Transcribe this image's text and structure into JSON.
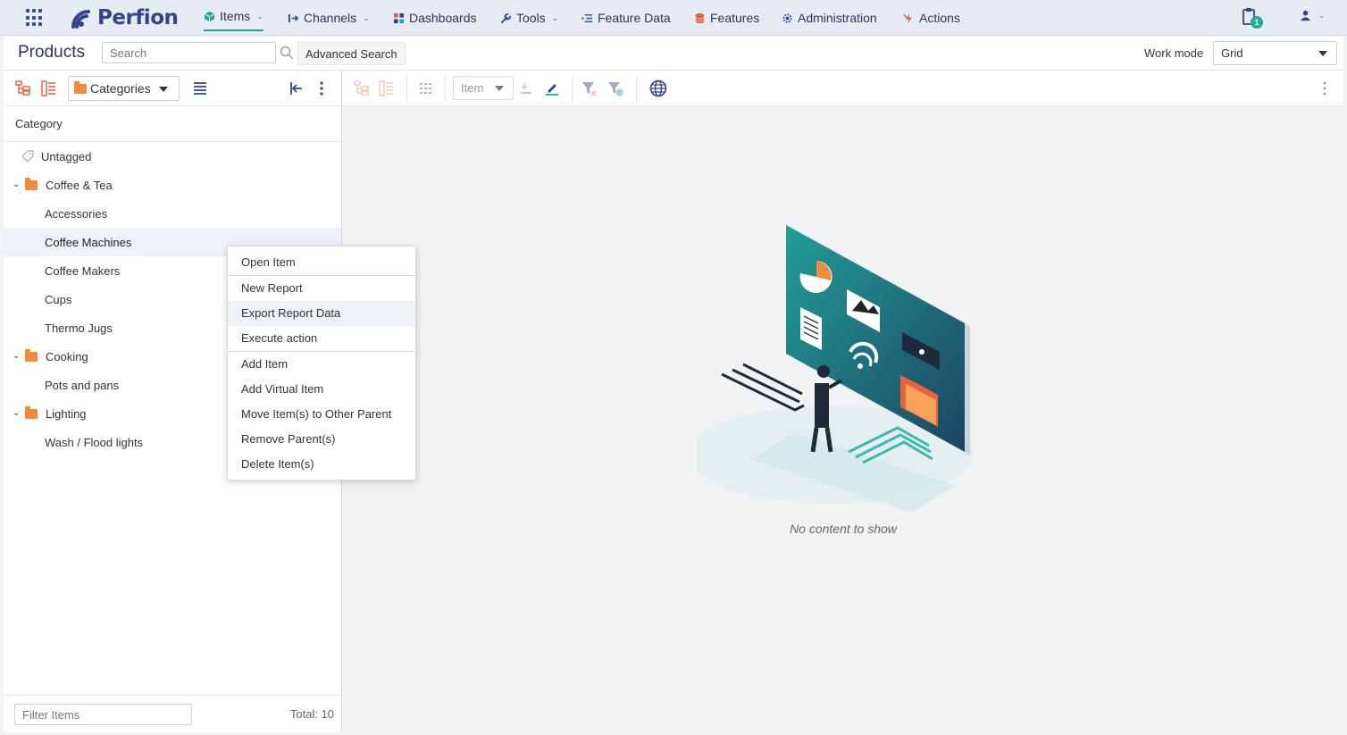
{
  "app": {
    "name": "Perfion",
    "nav": [
      {
        "label": "Items",
        "has_menu": true,
        "active": true
      },
      {
        "label": "Channels",
        "has_menu": true
      },
      {
        "label": "Dashboards",
        "has_menu": false
      },
      {
        "label": "Tools",
        "has_menu": true
      },
      {
        "label": "Feature Data",
        "has_menu": false
      },
      {
        "label": "Features",
        "has_menu": false
      },
      {
        "label": "Administration",
        "has_menu": false
      },
      {
        "label": "Actions",
        "has_menu": false
      }
    ],
    "notification_count": "1"
  },
  "header": {
    "title": "Products",
    "search_placeholder": "Search",
    "advanced_search_label": "Advanced Search",
    "work_mode_label": "Work mode",
    "work_mode_value": "Grid"
  },
  "left_panel": {
    "view_dropdown": "Categories",
    "column_header": "Category",
    "tree": [
      {
        "label": "Untagged",
        "level": 0,
        "type": "tag"
      },
      {
        "label": "Coffee & Tea",
        "level": 0,
        "type": "folder",
        "expanded": true
      },
      {
        "label": "Accessories",
        "level": 1
      },
      {
        "label": "Coffee Machines",
        "level": 1,
        "selected": true
      },
      {
        "label": "Coffee Makers",
        "level": 1
      },
      {
        "label": "Cups",
        "level": 1
      },
      {
        "label": "Thermo Jugs",
        "level": 1
      },
      {
        "label": "Cooking",
        "level": 0,
        "type": "folder",
        "expanded": true
      },
      {
        "label": "Pots and pans",
        "level": 1
      },
      {
        "label": "Lighting",
        "level": 0,
        "type": "folder",
        "expanded": true
      },
      {
        "label": "Wash / Flood lights",
        "level": 1
      }
    ],
    "filter_placeholder": "Filter Items",
    "total_label": "Total: 10"
  },
  "right_area": {
    "item_dropdown": "Item",
    "empty_message": "No content to show"
  },
  "context_menu": {
    "groups": [
      [
        "Open Item"
      ],
      [
        "New Report",
        "Export Report Data",
        "Execute action"
      ],
      [
        "Add Item",
        "Add Virtual Item",
        "Move Item(s) to Other Parent",
        "Remove Parent(s)",
        "Delete Item(s)"
      ]
    ],
    "hovered": "Export Report Data"
  },
  "colors": {
    "accent_teal": "#19a59a",
    "brand_navy": "#34448a",
    "folder_orange": "#f08a3e"
  }
}
